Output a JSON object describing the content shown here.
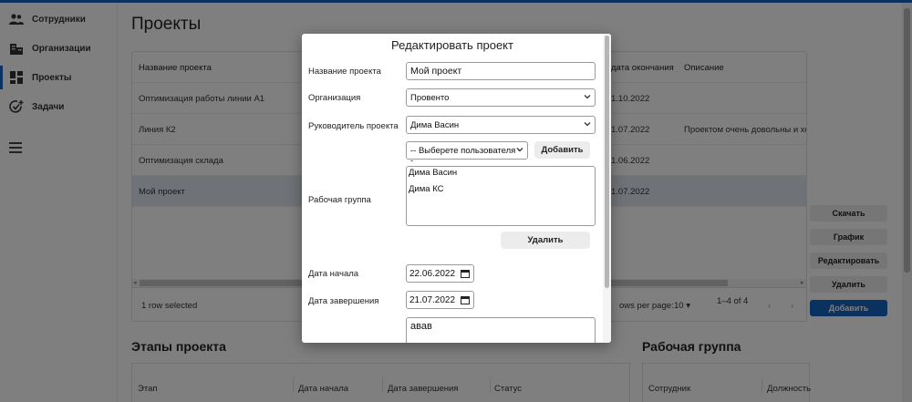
{
  "sidebar": {
    "items": [
      {
        "label": "Сотрудники",
        "icon": "people-icon"
      },
      {
        "label": "Организации",
        "icon": "building-icon"
      },
      {
        "label": "Проекты",
        "icon": "dashboard-icon"
      },
      {
        "label": "Задачи",
        "icon": "add-task-icon"
      }
    ],
    "menu_icon": "menu-icon"
  },
  "page": {
    "title": "Проекты"
  },
  "grid": {
    "columns": [
      "Название проекта",
      "дата окончания",
      "Описание"
    ],
    "rows": [
      {
        "name": "Оптимизация работы линии А1",
        "end": "1.10.2022",
        "desc": ""
      },
      {
        "name": "Линия К2",
        "end": "1.07.2022",
        "desc": "Проектом очень довольны и хо"
      },
      {
        "name": "Оптимизация склада",
        "end": "1.06.2022",
        "desc": ""
      },
      {
        "name": "Мой проект",
        "end": "1.07.2022",
        "desc": ""
      }
    ],
    "footer": {
      "selected": "1 row selected",
      "rows_per_page_label": "ows per page:",
      "rows_per_page": "10",
      "range": "1–4 of 4"
    }
  },
  "actions": {
    "download": "Скачать",
    "chart": "График",
    "edit": "Редактировать",
    "delete": "Удалить",
    "add": "Добавить"
  },
  "stages": {
    "title": "Этапы проекта",
    "columns": [
      "Этап",
      "Дата начала",
      "Дата завершения",
      "Статус"
    ]
  },
  "workgroup": {
    "title": "Рабочая группа",
    "columns": [
      "Сотрудник",
      "Должность"
    ]
  },
  "modal": {
    "title": "Редактировать проект",
    "name_label": "Название проекта",
    "name_value": "Мой проект",
    "org_label": "Организация",
    "org_value": "Провенто",
    "manager_label": "Руководитель проекта",
    "manager_value": "Дима Васин",
    "user_select_value": "-- Выберете пользователя --",
    "add_button": "Добавить",
    "workgroup_label": "Рабочая группа",
    "workgroup_members": [
      "Дима Васин",
      "Дима КС"
    ],
    "delete_button": "Удалить",
    "start_label": "Дата начала",
    "start_value": "22.06.2022",
    "end_label": "Дата завершения",
    "end_value": "21.07.2022",
    "description_value": "авав"
  },
  "colors": {
    "accent": "#1565c0",
    "selected_row": "#dfe7ef"
  }
}
